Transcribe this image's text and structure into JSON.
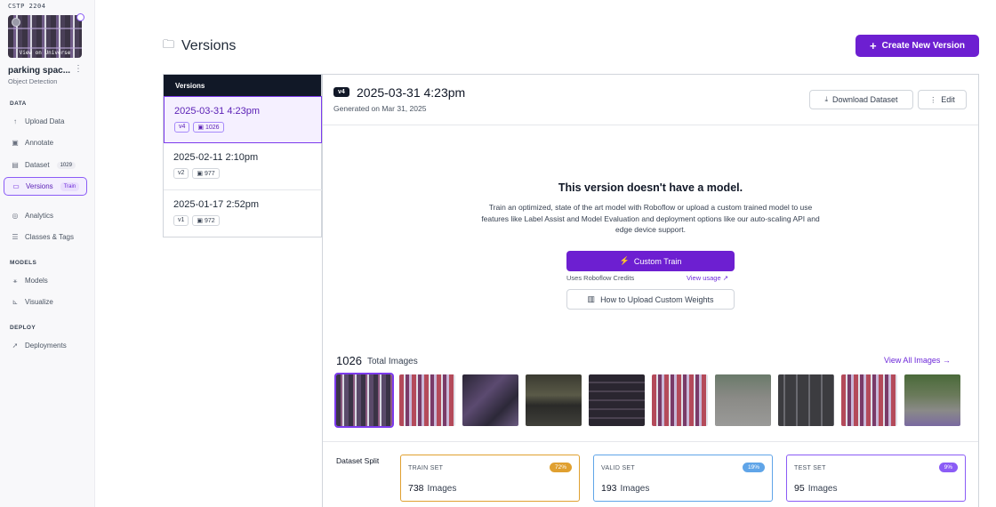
{
  "sidebar": {
    "workspace": "CSTP 2204",
    "thumbnail_label": "View on Universe",
    "project_name": "parking spac...",
    "project_type": "Object Detection",
    "sections": {
      "data": "DATA",
      "models": "MODELS",
      "deploy": "DEPLOY"
    },
    "items": {
      "upload": "Upload Data",
      "annotate": "Annotate",
      "dataset": "Dataset",
      "dataset_count": "1029",
      "versions": "Versions",
      "versions_badge": "Train",
      "analytics": "Analytics",
      "classes": "Classes & Tags",
      "models": "Models",
      "visualize": "Visualize",
      "deployments": "Deployments"
    }
  },
  "header": {
    "title": "Versions",
    "create_button": "Create New Version"
  },
  "versions_list": {
    "header": "Versions",
    "items": [
      {
        "date": "2025-03-31 4:23pm",
        "version": "v4",
        "images": "1026"
      },
      {
        "date": "2025-02-11 2:10pm",
        "version": "v2",
        "images": "977"
      },
      {
        "date": "2025-01-17 2:52pm",
        "version": "v1",
        "images": "972"
      }
    ]
  },
  "detail": {
    "version_tag": "v4",
    "title": "2025-03-31 4:23pm",
    "subtitle": "Generated on Mar 31, 2025",
    "download_button": "Download Dataset",
    "edit_button": "Edit",
    "no_model_title": "This version doesn't have a model.",
    "no_model_desc": "Train an optimized, state of the art model with Roboflow or upload a custom trained model to use features like Label Assist and Model Evaluation and deployment options like our auto-scaling API and edge device support.",
    "custom_train_button": "Custom Train",
    "credits_note": "Uses Roboflow Credits",
    "view_usage_link": "View usage ↗",
    "howto_button": "How to Upload Custom Weights",
    "total_images_count": "1026",
    "total_images_label": "Total Images",
    "view_all_link": "View All Images →",
    "dataset_split_title": "Dataset Split",
    "splits": [
      {
        "label": "TRAIN SET",
        "count": "738",
        "unit": "Images",
        "percent": "72%",
        "color": "#e0a030"
      },
      {
        "label": "VALID SET",
        "count": "193",
        "unit": "Images",
        "percent": "19%",
        "color": "#60a5e8"
      },
      {
        "label": "TEST SET",
        "count": "95",
        "unit": "Images",
        "percent": "9%",
        "color": "#8b5cf6"
      }
    ]
  },
  "icons": {
    "upload": "arrow-up-icon",
    "annotate": "annotate-icon",
    "dataset": "image-icon",
    "versions": "folders-icon",
    "analytics": "analytics-icon",
    "classes": "list-icon",
    "models": "models-icon",
    "visualize": "chart-icon",
    "deployments": "rocket-icon"
  },
  "colors": {
    "accent": "#6d1fd1",
    "sidebar_bg": "#f8f8fa",
    "list_header": "#111827"
  }
}
